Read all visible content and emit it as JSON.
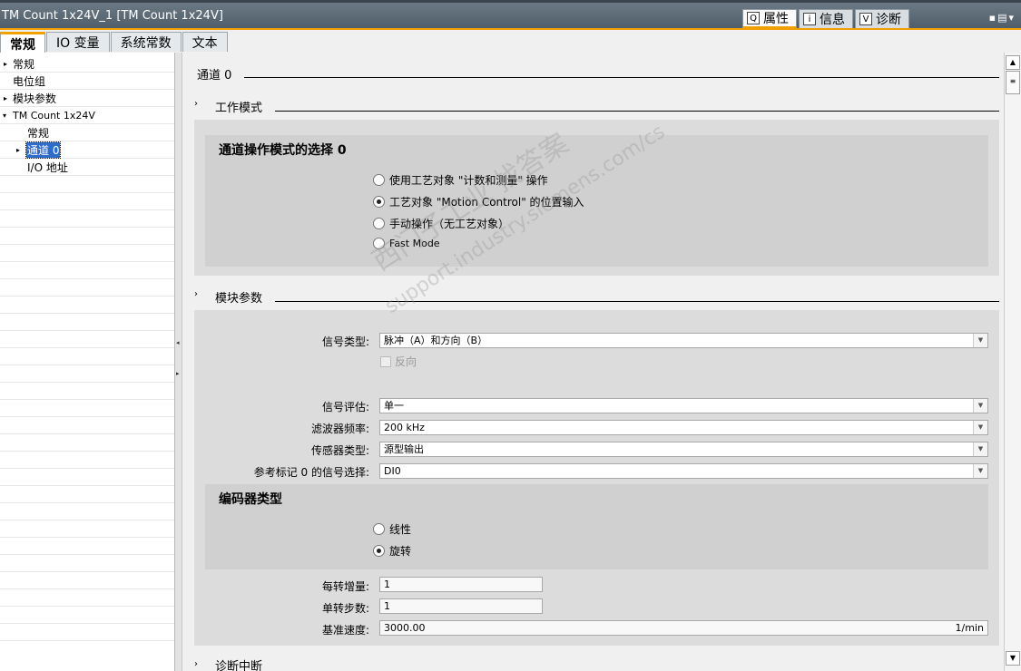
{
  "window": {
    "title": "TM Count 1x24V_1 [TM Count 1x24V]",
    "controls": "▪▤▾"
  },
  "inspector_tabs": [
    {
      "label": "属性",
      "icon": "properties-icon",
      "glyph": "Q"
    },
    {
      "label": "信息",
      "icon": "info-icon",
      "glyph": "i"
    },
    {
      "label": "诊断",
      "icon": "diagnostics-icon",
      "glyph": "V"
    }
  ],
  "main_tabs": [
    "常规",
    "IO 变量",
    "系统常数",
    "文本"
  ],
  "tree": [
    {
      "label": "常规",
      "expand": "▸"
    },
    {
      "label": "电位组",
      "expand": ""
    },
    {
      "label": "模块参数",
      "expand": "▸"
    },
    {
      "label": "TM Count 1x24V",
      "expand": "▾"
    },
    {
      "label": "常规",
      "expand": ""
    },
    {
      "label": "通道 0",
      "expand": "▸"
    },
    {
      "label": "I/O 地址",
      "expand": ""
    }
  ],
  "content": {
    "channel_title": "通道 0",
    "section_work_mode": "工作模式",
    "channel_op_mode_heading": "通道操作模式的选择 0",
    "op_modes": [
      {
        "label": "使用工艺对象 \"计数和测量\" 操作",
        "selected": false
      },
      {
        "label": "工艺对象 \"Motion Control\" 的位置输入",
        "selected": true
      },
      {
        "label": "手动操作（无工艺对象）",
        "selected": false
      },
      {
        "label": "Fast Mode",
        "selected": false
      }
    ],
    "section_module_params": "模块参数",
    "signal_type": {
      "label": "信号类型:",
      "value": "脉冲（A）和方向（B）"
    },
    "invert": {
      "label": "反向",
      "checked": false
    },
    "signal_eval": {
      "label": "信号评估:",
      "value": "单一"
    },
    "filter_freq": {
      "label": "滤波器频率:",
      "value": "200 kHz"
    },
    "sensor_type": {
      "label": "传感器类型:",
      "value": "源型输出"
    },
    "ref_mark": {
      "label": "参考标记 0 的信号选择:",
      "value": "DI0"
    },
    "encoder_type_heading": "编码器类型",
    "encoder_types": [
      {
        "label": "线性",
        "selected": false
      },
      {
        "label": "旋转",
        "selected": true
      }
    ],
    "increments_per_rev": {
      "label": "每转增量:",
      "value": "1"
    },
    "steps_per_rev": {
      "label": "单转步数:",
      "value": "1"
    },
    "ref_speed": {
      "label": "基准速度:",
      "value": "3000.00",
      "unit": "1/min"
    },
    "section_diag": "诊断中断"
  },
  "watermark": {
    "line1": "西门子工业  找答案",
    "line2": "support.industry.siemens.com/cs"
  }
}
